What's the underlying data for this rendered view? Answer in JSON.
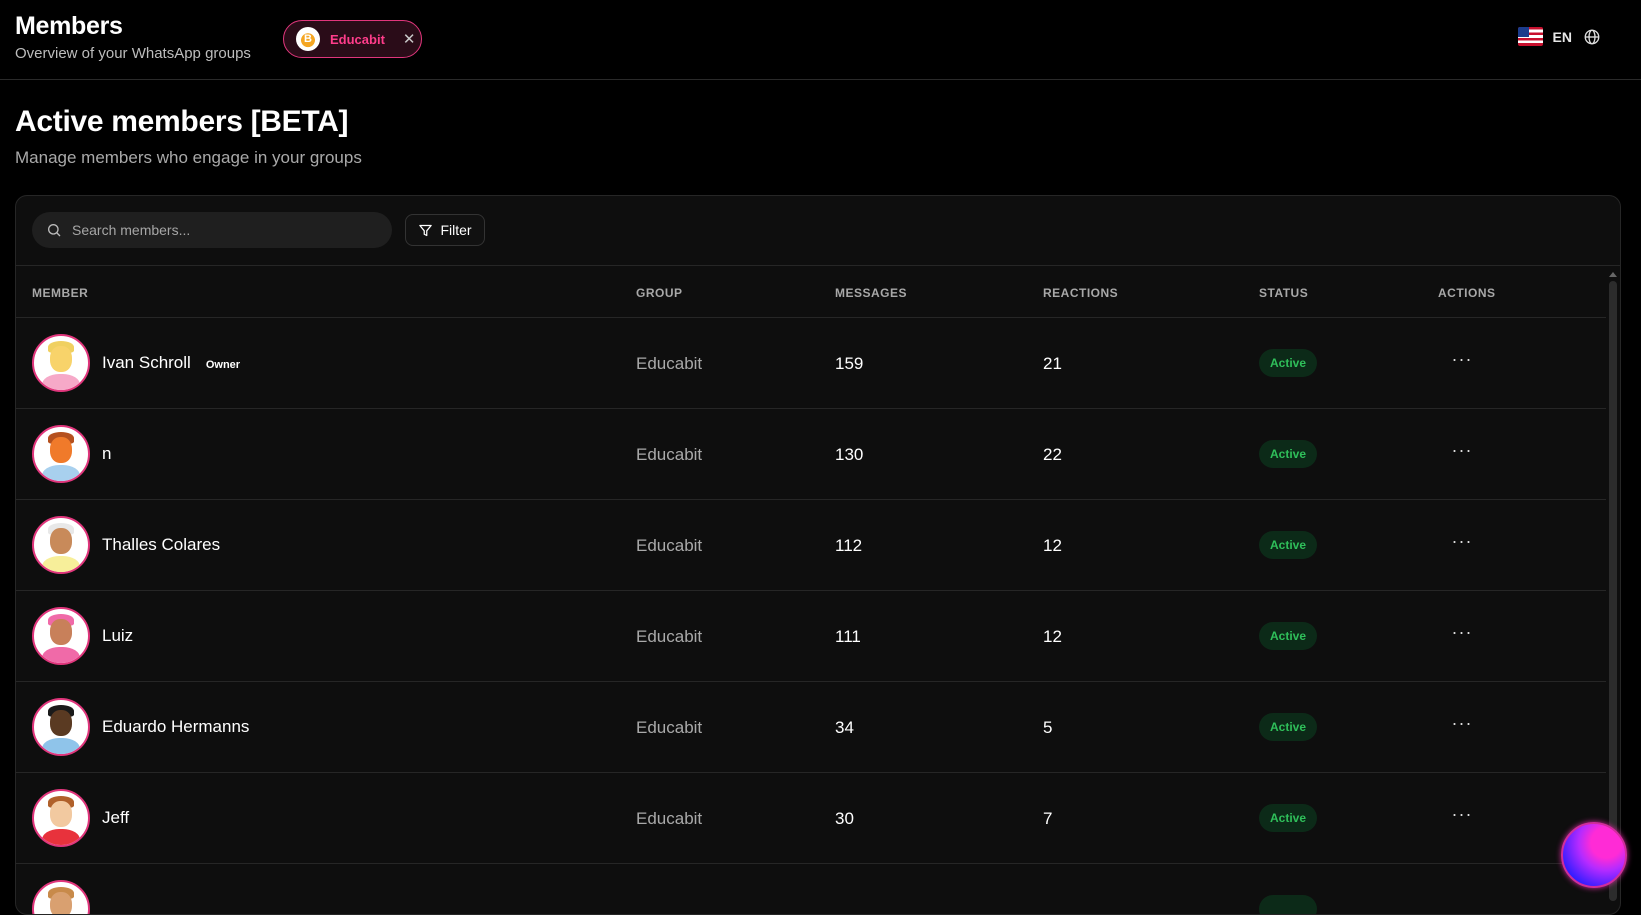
{
  "header": {
    "title": "Members",
    "subtitle": "Overview of your WhatsApp groups",
    "chip": {
      "label": "Educabit",
      "logo_letter": "B",
      "close_icon": "close-icon"
    },
    "language": {
      "code": "EN",
      "flag_icon": "us-flag-icon",
      "globe_icon": "globe-icon"
    }
  },
  "page": {
    "heading": "Active members [BETA]",
    "subheading": "Manage members who engage in your groups"
  },
  "toolbar": {
    "search_placeholder": "Search members...",
    "filter_label": "Filter"
  },
  "table": {
    "columns": [
      "MEMBER",
      "GROUP",
      "MESSAGES",
      "REACTIONS",
      "STATUS",
      "ACTIONS"
    ],
    "rows": [
      {
        "name": "Ivan Schroll",
        "badge": "Owner",
        "group": "Educabit",
        "messages": "159",
        "reactions": "21",
        "status": "Active",
        "actions": "···"
      },
      {
        "name": "n",
        "badge": "",
        "group": "Educabit",
        "messages": "130",
        "reactions": "22",
        "status": "Active",
        "actions": "···"
      },
      {
        "name": "Thalles Colares",
        "badge": "",
        "group": "Educabit",
        "messages": "112",
        "reactions": "12",
        "status": "Active",
        "actions": "···"
      },
      {
        "name": "Luiz",
        "badge": "",
        "group": "Educabit",
        "messages": "111",
        "reactions": "12",
        "status": "Active",
        "actions": "···"
      },
      {
        "name": "Eduardo Hermanns",
        "badge": "",
        "group": "Educabit",
        "messages": "34",
        "reactions": "5",
        "status": "Active",
        "actions": "···"
      },
      {
        "name": "Jeff",
        "badge": "",
        "group": "Educabit",
        "messages": "30",
        "reactions": "7",
        "status": "Active",
        "actions": "···"
      },
      {
        "name": "",
        "badge": "",
        "group": "",
        "messages": "",
        "reactions": "",
        "status": "",
        "actions": ""
      }
    ]
  },
  "colors": {
    "accent": "#e0367c",
    "status_active_text": "#2fbf5a",
    "status_active_bg": "#0c2a18"
  }
}
